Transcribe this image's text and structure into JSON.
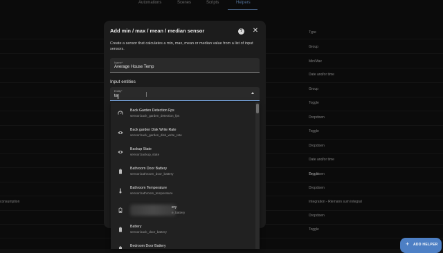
{
  "tabs": [
    {
      "label": "Automations"
    },
    {
      "label": "Scenes"
    },
    {
      "label": "Scripts"
    },
    {
      "label": "Helpers"
    }
  ],
  "active_tab": "Helpers",
  "background_rows": [
    {
      "type": "Type"
    },
    {
      "type": "Group"
    },
    {
      "type": "Min/Max"
    },
    {
      "type": "Date and/or time"
    },
    {
      "type": "Group"
    },
    {
      "type": "Toggle"
    },
    {
      "type": "Dropdown"
    },
    {
      "type": "Toggle"
    },
    {
      "type": "Dropdown"
    },
    {
      "type": "Date and/or time"
    },
    {
      "type": "Dropdown"
    },
    {
      "type": "Toggle"
    },
    {
      "type": "Dropdown"
    },
    {
      "type": "Integration - Riemann sum integral",
      "left": "consumption"
    },
    {
      "type": "Dropdown"
    },
    {
      "type": "Toggle"
    }
  ],
  "dialog": {
    "title": "Add min / max / mean / median sensor",
    "description": "Create a sensor that calculates a min, max, mean or median value from a list of input sensors.",
    "name_label": "Name*",
    "name_value": "Average House Temp",
    "section_title": "Input entities",
    "entity_label": "Entity*",
    "entity_value": "te"
  },
  "dropdown": {
    "items": [
      {
        "name": "Back Garden Detection Fps",
        "sub": "sensor.back_garden_detection_fps",
        "icon": "gauge-icon"
      },
      {
        "name": "Back garden Disk Write Rate",
        "sub": "sensor.back_garden_disk_write_rate",
        "icon": "eye-icon"
      },
      {
        "name": "Backup State",
        "sub": "sensor.backup_state",
        "icon": "eye-icon"
      },
      {
        "name": "Bathroom Door Battery",
        "sub": "sensor.bathroom_door_battery",
        "icon": "battery-icon"
      },
      {
        "name": "Bathroom Temperature",
        "sub": "sensor.bathroom_temperature",
        "icon": "thermometer-icon"
      },
      {
        "name": "ery",
        "sub": "e_battery",
        "icon": "battery-low-icon"
      },
      {
        "name": "Battery",
        "sub": "sensor.back_door_battery",
        "icon": "battery-icon"
      },
      {
        "name": "Bedroom Door Battery",
        "sub": "",
        "icon": "battery-icon"
      }
    ]
  },
  "fab": {
    "label": "ADD HELPER",
    "icon": "+"
  }
}
